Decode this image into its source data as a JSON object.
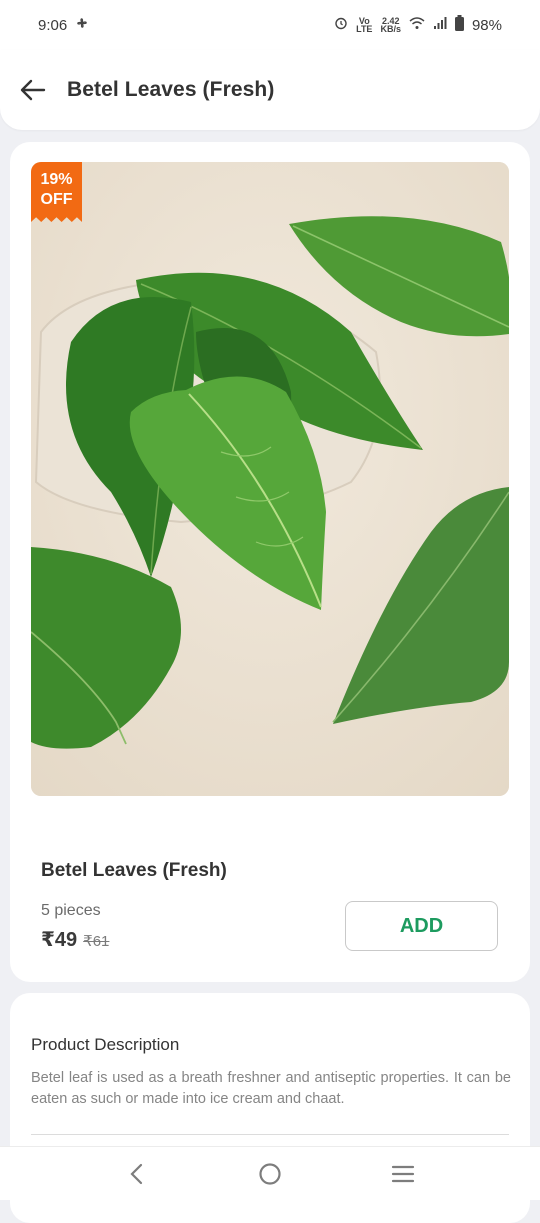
{
  "status_bar": {
    "time": "9:06",
    "network_top": "Vo",
    "network_bottom": "LTE",
    "speed_top": "2.42",
    "speed_bottom": "KB/s",
    "battery": "98%"
  },
  "header": {
    "title": "Betel Leaves (Fresh)",
    "back_icon": "arrow-left-icon"
  },
  "product": {
    "discount_line1": "19%",
    "discount_line2": "OFF",
    "name": "Betel Leaves (Fresh)",
    "quantity": "5 pieces",
    "price": "₹49",
    "mrp": "₹61",
    "add_label": "ADD"
  },
  "description": {
    "title": "Product Description",
    "text": "Betel leaf is used as a breath freshner and antiseptic properties. It can be eaten as such or made into ice cream and chaat."
  },
  "colors": {
    "accent_green": "#1d9b5f",
    "discount_orange": "#f26a13",
    "page_background": "#eff0f4"
  },
  "nav": {
    "back_icon": "chevron-left-icon",
    "home_icon": "circle-home-icon",
    "menu_icon": "hamburger-menu-icon"
  }
}
